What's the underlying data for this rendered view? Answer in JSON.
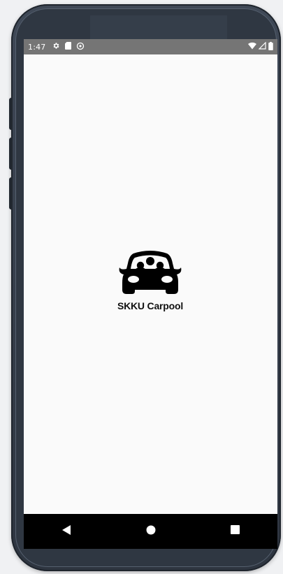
{
  "status_bar": {
    "time": "1:47",
    "left_icons": [
      "gear-icon",
      "sd-card-icon",
      "sync-icon"
    ],
    "right_icons": [
      "wifi-icon",
      "cell-signal-icon",
      "battery-icon"
    ]
  },
  "splash": {
    "app_name": "SKKU Carpool",
    "logo_icon": "car-passengers-icon"
  },
  "nav_bar": {
    "buttons": [
      "back-icon",
      "home-icon",
      "recents-icon"
    ]
  },
  "colors": {
    "status_bar_bg": "#757575",
    "screen_bg": "#fafafa",
    "nav_bar_bg": "#000000",
    "device_frame": "#2f3742"
  }
}
